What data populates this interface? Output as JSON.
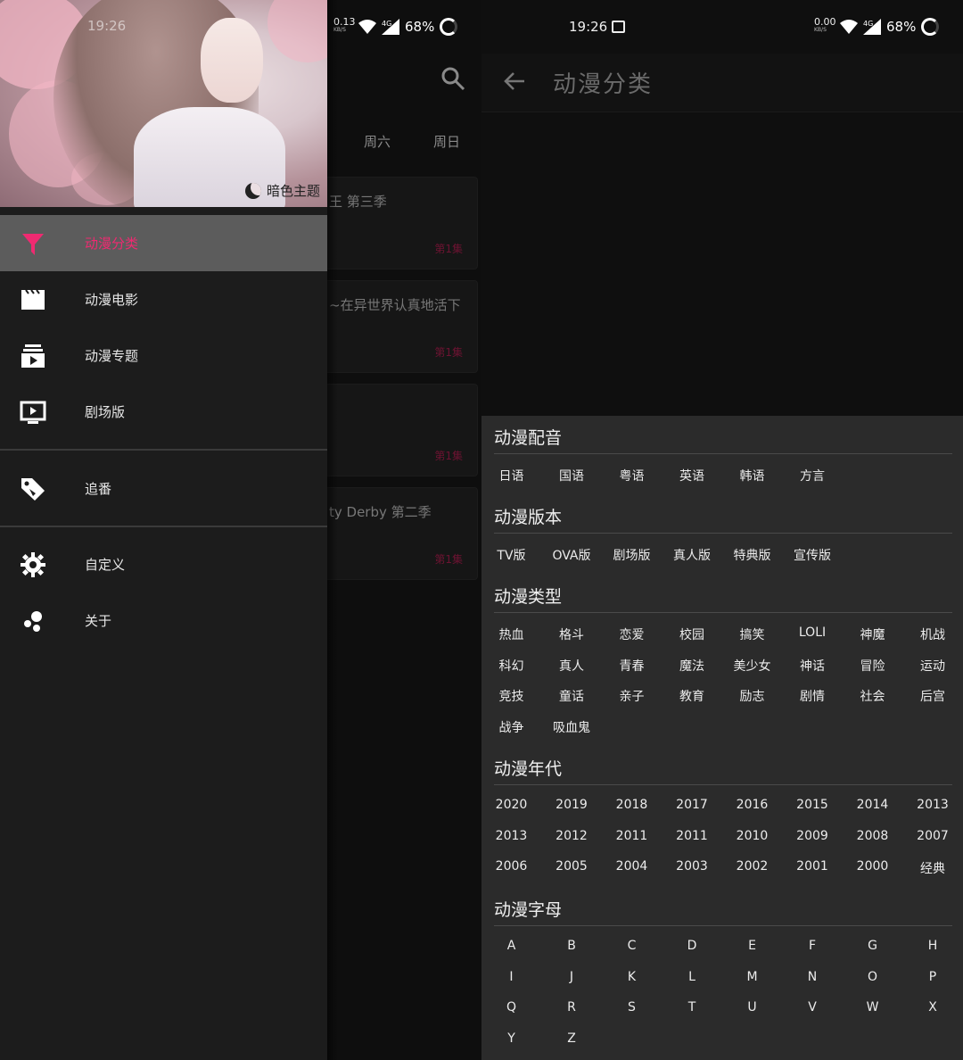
{
  "left": {
    "status": {
      "net_speed": "0.13",
      "net_unit": "KB/S",
      "battery": "68%",
      "network": "4G"
    },
    "background_tabs": [
      "周六",
      "周日"
    ],
    "background_cards": [
      {
        "title": "王 第三季",
        "episode": "第1集"
      },
      {
        "title": "~在异世界认真地活下",
        "episode": "第1集"
      },
      {
        "title": "",
        "episode": "第1集"
      },
      {
        "title": "ty Derby 第二季",
        "episode": "第1集"
      }
    ],
    "drawer": {
      "header_time": "19:26",
      "theme_label": "暗色主题",
      "items": [
        {
          "label": "动漫分类",
          "icon": "filter-icon",
          "active": true
        },
        {
          "label": "动漫电影",
          "icon": "movie-icon"
        },
        {
          "label": "动漫专题",
          "icon": "subscriptions-icon"
        },
        {
          "label": "剧场版",
          "icon": "tv-play-icon"
        },
        {
          "label": "追番",
          "icon": "tag-icon"
        },
        {
          "label": "自定义",
          "icon": "gear-icon"
        },
        {
          "label": "关于",
          "icon": "bubbles-icon"
        }
      ]
    }
  },
  "right": {
    "status": {
      "time": "19:26",
      "net_speed": "0.00",
      "net_unit": "KB/S",
      "battery": "68%",
      "network": "4G"
    },
    "title": "动漫分类",
    "sections": [
      {
        "title": "动漫配音",
        "options": [
          "日语",
          "国语",
          "粤语",
          "英语",
          "韩语",
          "方言"
        ]
      },
      {
        "title": "动漫版本",
        "options": [
          "TV版",
          "OVA版",
          "剧场版",
          "真人版",
          "特典版",
          "宣传版"
        ]
      },
      {
        "title": "动漫类型",
        "options": [
          "热血",
          "格斗",
          "恋爱",
          "校园",
          "搞笑",
          "LOLI",
          "神魔",
          "机战",
          "科幻",
          "真人",
          "青春",
          "魔法",
          "美少女",
          "神话",
          "冒险",
          "运动",
          "竞技",
          "童话",
          "亲子",
          "教育",
          "励志",
          "剧情",
          "社会",
          "后宫",
          "战争",
          "吸血鬼"
        ]
      },
      {
        "title": "动漫年代",
        "options": [
          "2020",
          "2019",
          "2018",
          "2017",
          "2016",
          "2015",
          "2014",
          "2013",
          "2013",
          "2012",
          "2011",
          "2011",
          "2010",
          "2009",
          "2008",
          "2007",
          "2006",
          "2005",
          "2004",
          "2003",
          "2002",
          "2001",
          "2000",
          "经典"
        ]
      },
      {
        "title": "动漫字母",
        "options": [
          "A",
          "B",
          "C",
          "D",
          "E",
          "F",
          "G",
          "H",
          "I",
          "J",
          "K",
          "L",
          "M",
          "N",
          "O",
          "P",
          "Q",
          "R",
          "S",
          "T",
          "U",
          "V",
          "W",
          "X",
          "Y",
          "Z"
        ]
      }
    ]
  },
  "colors": {
    "accent": "#ef2a71",
    "drawer_bg": "#1c1c1c",
    "active_item_bg": "#5c5c5c",
    "sheet_bg": "#2b2b2b"
  }
}
